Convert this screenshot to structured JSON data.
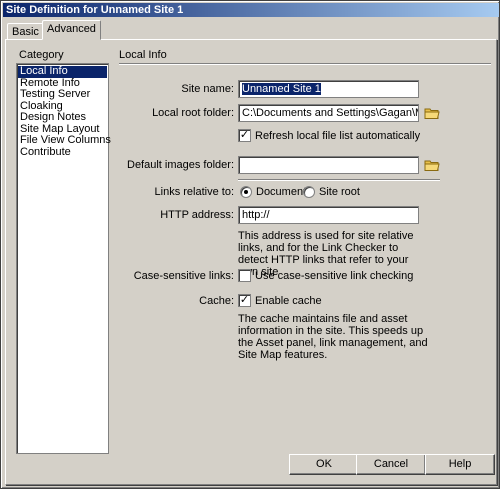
{
  "window": {
    "title": "Site Definition for Unnamed Site 1"
  },
  "tabs": [
    {
      "label": "Basic"
    },
    {
      "label": "Advanced"
    }
  ],
  "category": {
    "heading": "Category",
    "items": [
      "Local Info",
      "Remote Info",
      "Testing Server",
      "Cloaking",
      "Design Notes",
      "Site Map Layout",
      "File View Columns",
      "Contribute"
    ],
    "selected": "Local Info"
  },
  "panel": {
    "heading": "Local Info",
    "site_name": {
      "label": "Site name:",
      "value": "Unnamed Site 1"
    },
    "local_root": {
      "label": "Local root folder:",
      "value": "C:\\Documents and Settings\\Gagan\\My Dc"
    },
    "refresh": {
      "label": "Refresh local file list automatically",
      "checked": true
    },
    "default_images": {
      "label": "Default images folder:",
      "value": ""
    },
    "links_relative": {
      "label": "Links relative to:",
      "option_document": "Document",
      "option_site_root": "Site root",
      "selected": "Document"
    },
    "http_address": {
      "label": "HTTP address:",
      "value": "http://",
      "note": "This address is used for site relative links, and for the Link Checker to detect HTTP links that refer to your own site"
    },
    "case_sensitive": {
      "label": "Case-sensitive links:",
      "checkbox_label": "Use case-sensitive link checking",
      "checked": false
    },
    "cache": {
      "label": "Cache:",
      "checkbox_label": "Enable cache",
      "checked": true,
      "note": "The cache maintains file and asset information in the site.  This speeds up the Asset panel, link management, and Site Map features."
    }
  },
  "buttons": {
    "ok": "OK",
    "cancel": "Cancel",
    "help": "Help"
  },
  "colors": {
    "selection": "#0a246a",
    "folder": "#e8c04a"
  },
  "icons": {
    "folder": "folder-icon",
    "check": "checkmark"
  }
}
